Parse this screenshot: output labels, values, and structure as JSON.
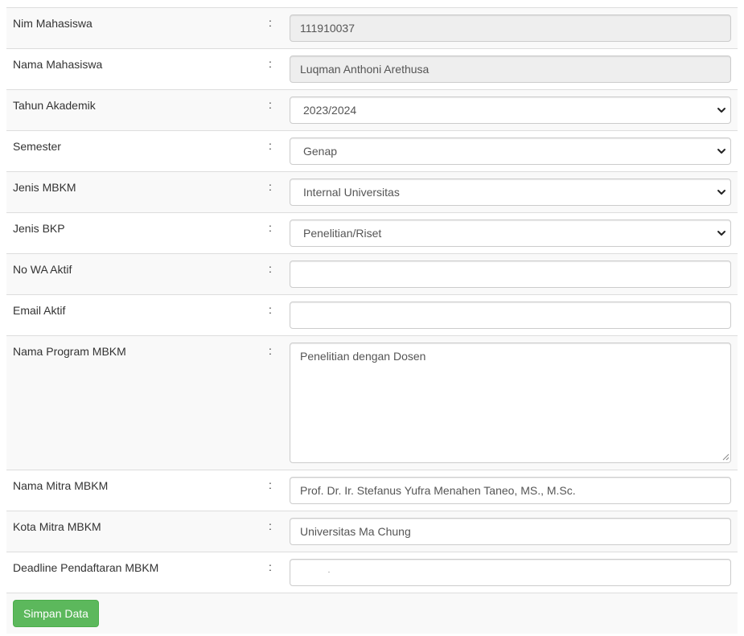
{
  "form": {
    "nim": {
      "label": "Nim Mahasiswa",
      "value": "111910037"
    },
    "nama": {
      "label": "Nama Mahasiswa",
      "value": "Luqman Anthoni Arethusa"
    },
    "tahun_akademik": {
      "label": "Tahun Akademik",
      "selected": "2023/2024"
    },
    "semester": {
      "label": "Semester",
      "selected": "Genap"
    },
    "jenis_mbkm": {
      "label": "Jenis MBKM",
      "selected": "Internal Universitas"
    },
    "jenis_bkp": {
      "label": "Jenis BKP",
      "selected": "Penelitian/Riset"
    },
    "no_wa": {
      "label": "No WA Aktif",
      "value": ""
    },
    "email": {
      "label": "Email Aktif",
      "value": ""
    },
    "nama_program": {
      "label": "Nama Program MBKM",
      "value": "Penelitian dengan Dosen"
    },
    "nama_mitra": {
      "label": "Nama Mitra MBKM",
      "value": "Prof. Dr. Ir. Stefanus Yufra Menahen Taneo, MS., M.Sc."
    },
    "kota_mitra": {
      "label": "Kota Mitra MBKM",
      "value": "Universitas Ma Chung"
    },
    "deadline": {
      "label": "Deadline Pendaftaran MBKM",
      "value": ""
    },
    "colon": ":"
  },
  "actions": {
    "save_label": "Simpan Data",
    "save_color": "#5cb85c"
  },
  "icons": {
    "select_arrow": "chevron-down-icon",
    "textarea_grip": "resize-grip-icon"
  }
}
